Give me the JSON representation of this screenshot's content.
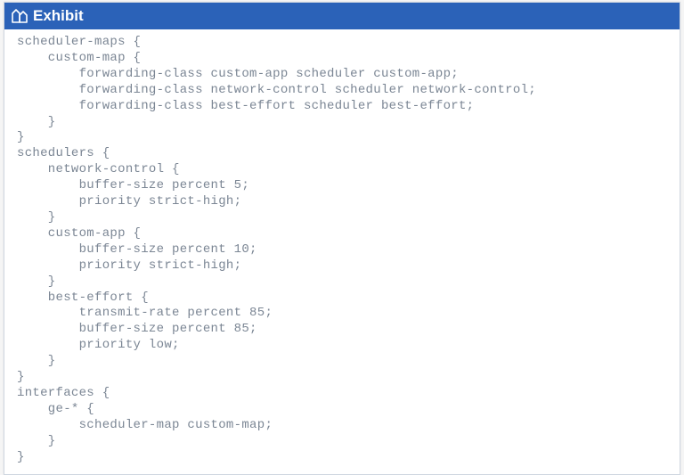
{
  "header": {
    "icon_name": "exhibit-icon",
    "title": "Exhibit"
  },
  "code": {
    "lines": [
      "scheduler-maps {",
      "    custom-map {",
      "        forwarding-class custom-app scheduler custom-app;",
      "        forwarding-class network-control scheduler network-control;",
      "        forwarding-class best-effort scheduler best-effort;",
      "    }",
      "}",
      "schedulers {",
      "    network-control {",
      "        buffer-size percent 5;",
      "        priority strict-high;",
      "    }",
      "    custom-app {",
      "        buffer-size percent 10;",
      "        priority strict-high;",
      "    }",
      "    best-effort {",
      "        transmit-rate percent 85;",
      "        buffer-size percent 85;",
      "        priority low;",
      "    }",
      "}",
      "interfaces {",
      "    ge-* {",
      "        scheduler-map custom-map;",
      "    }",
      "}"
    ]
  }
}
